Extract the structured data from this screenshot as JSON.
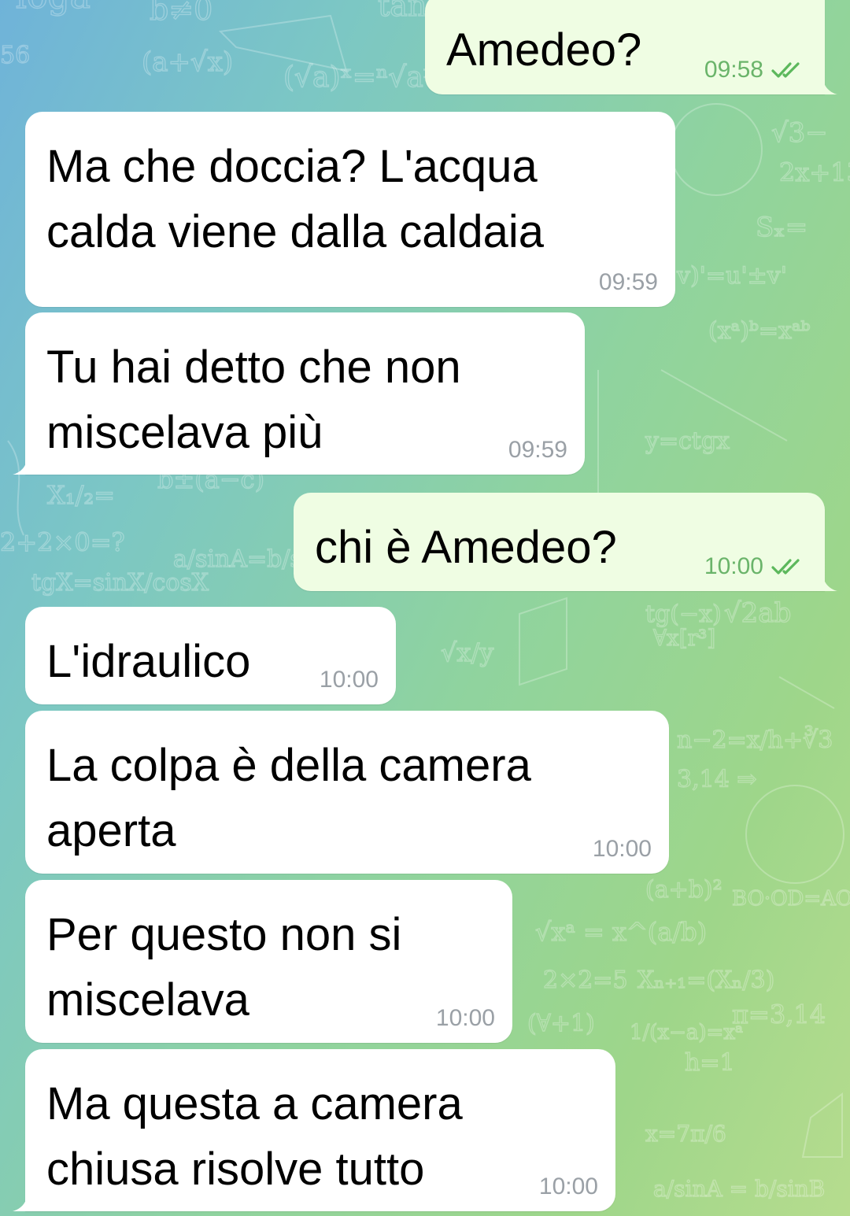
{
  "colors": {
    "incoming_bubble": "#ffffff",
    "outgoing_bubble": "#effde3",
    "outgoing_time": "#6ab46a",
    "incoming_time": "#9aa0a6",
    "read_check": "#5cb85c"
  },
  "messages": [
    {
      "direction": "out",
      "text": "Amedeo?",
      "time": "09:58",
      "status_icon": "double-check-icon"
    },
    {
      "direction": "in",
      "text": "Ma che doccia? L'acqua\ncalda viene dalla caldaia",
      "time": "09:59"
    },
    {
      "direction": "in",
      "text": "Tu hai detto che non\nmiscelava più",
      "time": "09:59"
    },
    {
      "direction": "out",
      "text": "chi è Amedeo?",
      "time": "10:00",
      "status_icon": "double-check-icon"
    },
    {
      "direction": "in",
      "text": "L'idraulico",
      "time": "10:00"
    },
    {
      "direction": "in",
      "text": "La colpa è della camera\naperta",
      "time": "10:00"
    },
    {
      "direction": "in",
      "text": "Per questo non si\nmiscelava",
      "time": "10:00"
    },
    {
      "direction": "in",
      "text": "Ma questa a camera\nchiusa risolve tutto",
      "time": "10:00"
    }
  ]
}
